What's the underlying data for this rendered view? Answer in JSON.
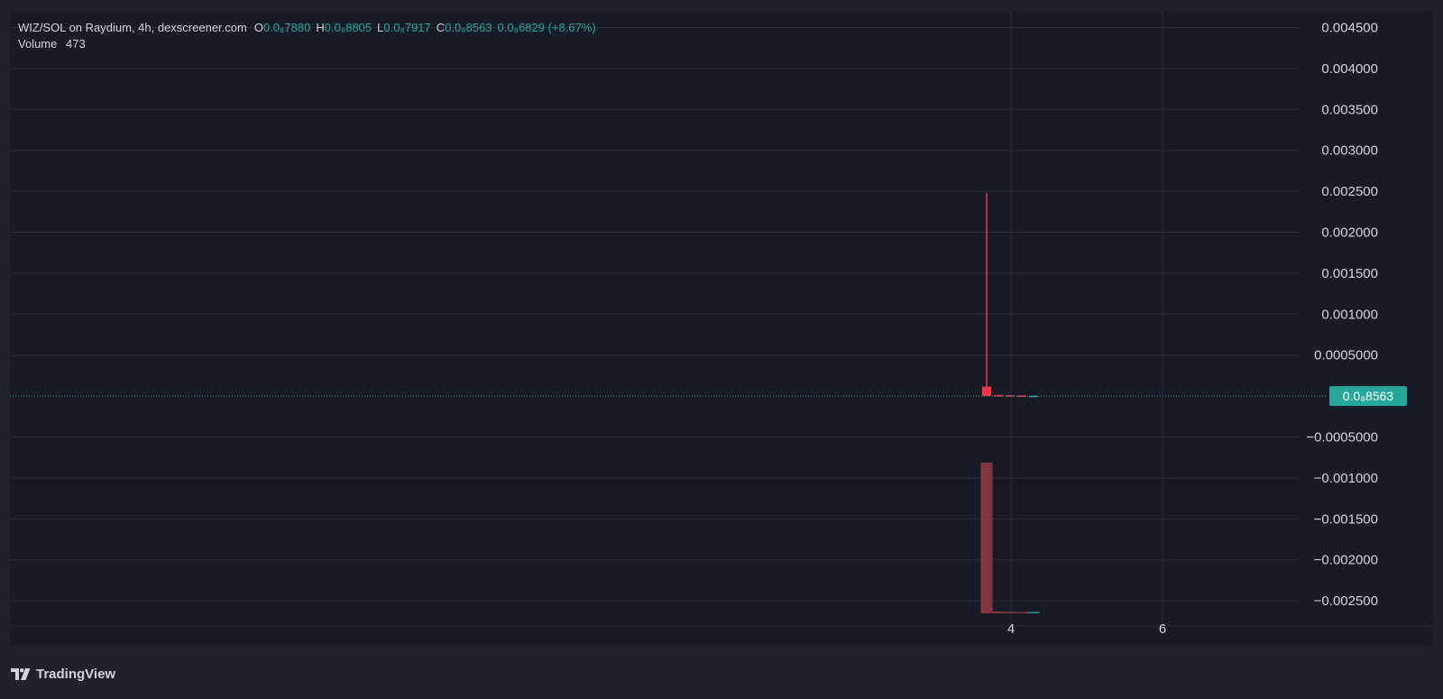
{
  "legend": {
    "title": "WIZ/SOL on Raydium, 4h, dexscreener.com",
    "o_key": "O",
    "o_val": "0.0₈7880",
    "h_key": "H",
    "h_val": "0.0₈8805",
    "l_key": "L",
    "l_val": "0.0₈7917",
    "c_key": "C",
    "c_val": "0.0₈8563",
    "change": "0.0₈6829 (+8.67%)",
    "volume_label": "Volume",
    "volume_val": "473"
  },
  "branding": {
    "name": "TradingView"
  },
  "colors": {
    "background": "#1e222d",
    "plot_bg": "#171b26",
    "up": "#26a69a",
    "down": "#f23645",
    "down_volume": "#8e3a44",
    "grid": "#2a2e39",
    "text": "#d1d4dc"
  },
  "chart_data": {
    "type": "candlestick",
    "title": "WIZ/SOL on Raydium, 4h, dexscreener.com",
    "ylim": [
      -0.0027,
      0.0047
    ],
    "y_ticks": [
      0.0045,
      0.004,
      0.0035,
      0.003,
      0.0025,
      0.002,
      0.0015,
      0.001,
      0.0005,
      -0.0005,
      -0.001,
      -0.0015,
      -0.002,
      -0.0025
    ],
    "y_tick_labels": [
      "0.004500",
      "0.004000",
      "0.003500",
      "0.003000",
      "0.002500",
      "0.002000",
      "0.001500",
      "0.001000",
      "0.0005000",
      "−0.0005000",
      "−0.001000",
      "−0.001500",
      "−0.002000",
      "−0.002500"
    ],
    "x_ticks": [
      "4",
      "6"
    ],
    "current_price_label": "0.0₈8563",
    "grid": true,
    "candles": [
      {
        "open": 0.000115,
        "high": 0.00248,
        "low": 0.0,
        "close": 0.0,
        "dir": "down"
      },
      {
        "open": 1.2e-05,
        "high": 1.6e-05,
        "low": 4e-06,
        "close": 6e-06,
        "dir": "down"
      },
      {
        "open": 9e-06,
        "high": 1.2e-05,
        "low": 4e-06,
        "close": 5e-06,
        "dir": "down"
      },
      {
        "open": 6e-06,
        "high": 9e-06,
        "low": 3e-06,
        "close": 4e-06,
        "dir": "down"
      },
      {
        "open": 2e-06,
        "high": 4e-06,
        "low": 1e-06,
        "close": 3e-06,
        "dir": "up"
      }
    ],
    "volume_series": [
      {
        "value": 1.0,
        "dir": "down"
      },
      {
        "value": 0.012,
        "dir": "down"
      },
      {
        "value": 0.01,
        "dir": "down"
      },
      {
        "value": 0.009,
        "dir": "down"
      },
      {
        "value": 0.008,
        "dir": "up"
      }
    ]
  }
}
